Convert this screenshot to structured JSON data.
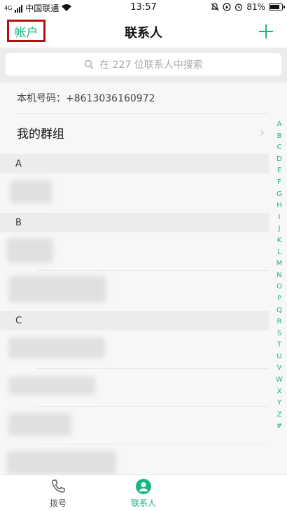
{
  "status_bar": {
    "carrier": "中国联通",
    "network": "4G",
    "time": "13:57",
    "battery": "81%",
    "battery_level": 0.81
  },
  "header": {
    "left_label": "帐户",
    "title": "联系人",
    "add_icon": "plus-icon"
  },
  "search": {
    "placeholder": "在 227 位联系人中搜索"
  },
  "own_number": "本机号码：+8613036160972",
  "group": {
    "label": "我的群组"
  },
  "sections": [
    {
      "letter": "A"
    },
    {
      "letter": "B"
    },
    {
      "letter": "C"
    }
  ],
  "alphabet": [
    "A",
    "B",
    "C",
    "D",
    "E",
    "F",
    "G",
    "H",
    "I",
    "J",
    "K",
    "L",
    "M",
    "N",
    "O",
    "P",
    "Q",
    "R",
    "S",
    "T",
    "U",
    "V",
    "W",
    "X",
    "Y",
    "Z",
    "#"
  ],
  "bottom_nav": {
    "dial_label": "拨号",
    "contacts_label": "联系人"
  },
  "colors": {
    "accent": "#18b57d",
    "highlight_border": "#b50f0f"
  }
}
